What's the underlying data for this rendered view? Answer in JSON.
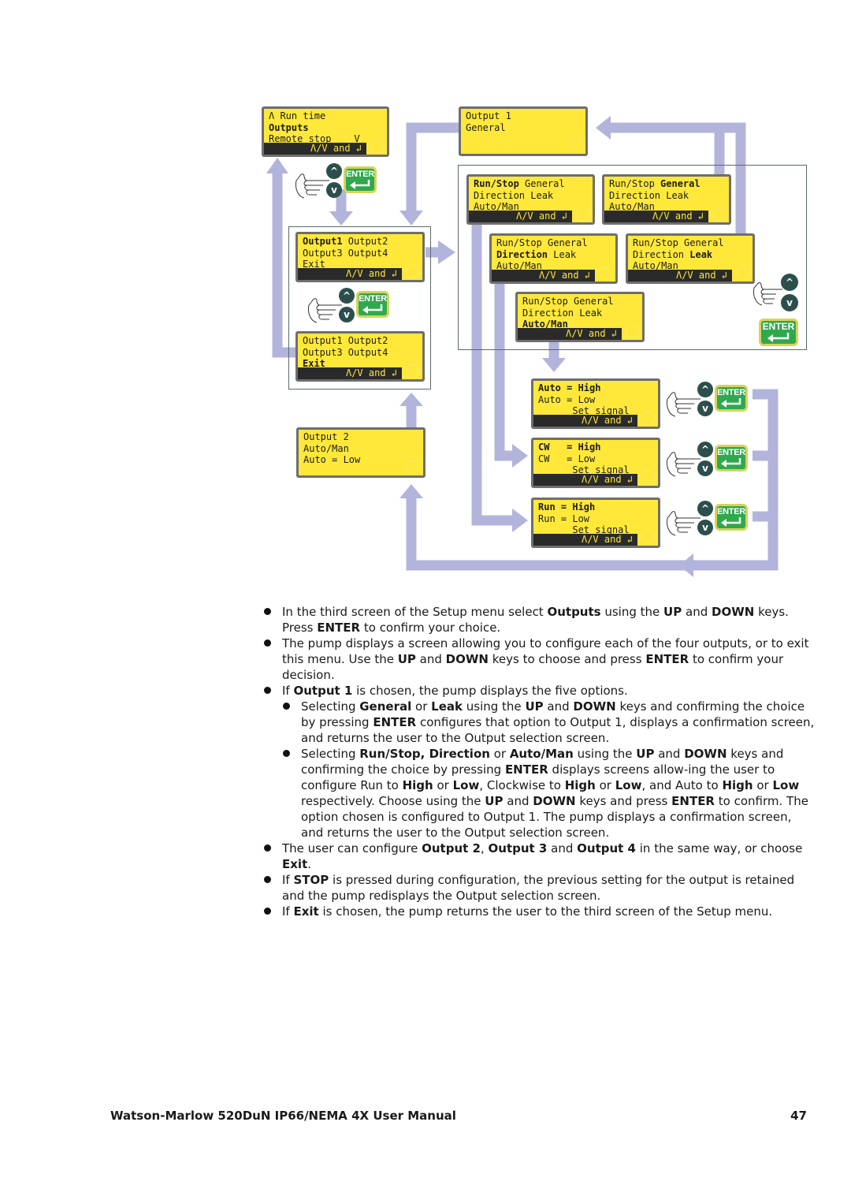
{
  "colors": {
    "lcd_background": "#ffe83a",
    "lcd_bar": "#2a2a2a",
    "arrow": "#b3b4dc",
    "enter_key": "#30a84e",
    "arrow_key": "#2c4f4d"
  },
  "diagram": {
    "nav_hint": "Λ/V and ↲",
    "keys": {
      "up_icon": "^",
      "down_icon": "v",
      "enter_label": "ENTER"
    },
    "screens": {
      "setup_menu": {
        "lines": [
          [
            {
              "t": "Λ Run time",
              "b": false
            }
          ],
          [
            {
              "t": "Outputs",
              "b": true
            }
          ],
          [
            {
              "t": "Remote stop    V",
              "b": false
            }
          ]
        ]
      },
      "output1_general_confirm": {
        "lines": [
          [
            {
              "t": "Output 1",
              "b": false
            }
          ],
          [
            {
              "t": "General",
              "b": false
            }
          ]
        ]
      },
      "outputs_select_output1": {
        "lines": [
          [
            {
              "t": "Output1",
              "b": true
            },
            {
              "t": " Output2",
              "b": false
            }
          ],
          [
            {
              "t": "Output3 Output4",
              "b": false
            }
          ],
          [
            {
              "t": "Exit",
              "b": false
            }
          ]
        ]
      },
      "outputs_select_exit": {
        "lines": [
          [
            {
              "t": "Output1 Output2",
              "b": false
            }
          ],
          [
            {
              "t": "Output3 Output4",
              "b": false
            }
          ],
          [
            {
              "t": "Exit",
              "b": true
            }
          ]
        ]
      },
      "output2_confirm": {
        "lines": [
          [
            {
              "t": "Output 2",
              "b": false
            }
          ],
          [
            {
              "t": "Auto/Man",
              "b": false
            }
          ],
          [
            {
              "t": "Auto = Low",
              "b": false
            }
          ]
        ]
      },
      "options_runstop": {
        "lines": [
          [
            {
              "t": "Run/Stop",
              "b": true
            },
            {
              "t": " General",
              "b": false
            }
          ],
          [
            {
              "t": "Direction Leak",
              "b": false
            }
          ],
          [
            {
              "t": "Auto/Man",
              "b": false
            }
          ]
        ]
      },
      "options_general": {
        "lines": [
          [
            {
              "t": "Run/Stop ",
              "b": false
            },
            {
              "t": "General",
              "b": true
            }
          ],
          [
            {
              "t": "Direction Leak",
              "b": false
            }
          ],
          [
            {
              "t": "Auto/Man",
              "b": false
            }
          ]
        ]
      },
      "options_direction": {
        "lines": [
          [
            {
              "t": "Run/Stop General",
              "b": false
            }
          ],
          [
            {
              "t": "Direction",
              "b": true
            },
            {
              "t": " Leak",
              "b": false
            }
          ],
          [
            {
              "t": "Auto/Man",
              "b": false
            }
          ]
        ]
      },
      "options_leak": {
        "lines": [
          [
            {
              "t": "Run/Stop General",
              "b": false
            }
          ],
          [
            {
              "t": "Direction ",
              "b": false
            },
            {
              "t": "Leak",
              "b": true
            }
          ],
          [
            {
              "t": "Auto/Man",
              "b": false
            }
          ]
        ]
      },
      "options_automan": {
        "lines": [
          [
            {
              "t": "Run/Stop General",
              "b": false
            }
          ],
          [
            {
              "t": "Direction Leak",
              "b": false
            }
          ],
          [
            {
              "t": "Auto/Man",
              "b": true
            }
          ]
        ]
      },
      "auto_setting": {
        "lines": [
          [
            {
              "t": "Auto = High",
              "b": true
            }
          ],
          [
            {
              "t": "Auto = Low",
              "b": false
            }
          ],
          [
            {
              "t": "      Set signal",
              "b": false
            }
          ]
        ]
      },
      "cw_setting": {
        "lines": [
          [
            {
              "t": "CW   = High",
              "b": true
            }
          ],
          [
            {
              "t": "CW   = Low",
              "b": false
            }
          ],
          [
            {
              "t": "      Set signal",
              "b": false
            }
          ]
        ]
      },
      "run_setting": {
        "lines": [
          [
            {
              "t": "Run = High",
              "b": true
            }
          ],
          [
            {
              "t": "Run = Low",
              "b": false
            }
          ],
          [
            {
              "t": "      Set signal",
              "b": false
            }
          ]
        ]
      }
    }
  },
  "body": {
    "bullets": [
      {
        "level": 0,
        "parts": [
          {
            "t": "In the third screen of the Setup menu  select "
          },
          {
            "t": "Outputs",
            "b": true
          },
          {
            "t": " using the "
          },
          {
            "t": "UP",
            "b": true
          },
          {
            "t": " and "
          },
          {
            "t": "DOWN",
            "b": true
          },
          {
            "t": " keys. Press "
          },
          {
            "t": "ENTER",
            "b": true
          },
          {
            "t": " to confirm your choice."
          }
        ]
      },
      {
        "level": 0,
        "parts": [
          {
            "t": "The pump displays a screen allowing you to configure each of the four outputs, or to exit this menu. Use the "
          },
          {
            "t": "UP",
            "b": true
          },
          {
            "t": " and "
          },
          {
            "t": "DOWN",
            "b": true
          },
          {
            "t": " keys to choose and press "
          },
          {
            "t": "ENTER",
            "b": true
          },
          {
            "t": " to confirm your decision."
          }
        ]
      },
      {
        "level": 0,
        "parts": [
          {
            "t": "If "
          },
          {
            "t": "Output 1",
            "b": true
          },
          {
            "t": " is chosen, the pump displays the five options."
          }
        ]
      },
      {
        "level": 1,
        "parts": [
          {
            "t": "Selecting "
          },
          {
            "t": "General",
            "b": true
          },
          {
            "t": " or  "
          },
          {
            "t": "Leak",
            "b": true
          },
          {
            "t": " using the "
          },
          {
            "t": "UP",
            "b": true
          },
          {
            "t": " and "
          },
          {
            "t": "DOWN",
            "b": true
          },
          {
            "t": " keys and confirming the choice by pressing "
          },
          {
            "t": "ENTER",
            "b": true
          },
          {
            "t": " configures that option to Output 1, displays a confirmation screen, and returns the user to the Output selection screen."
          }
        ]
      },
      {
        "level": 1,
        "parts": [
          {
            "t": "Selecting "
          },
          {
            "t": "Run/Stop, Direction",
            "b": true
          },
          {
            "t": " or "
          },
          {
            "t": "Auto/Man",
            "b": true
          },
          {
            "t": " using the "
          },
          {
            "t": "UP",
            "b": true
          },
          {
            "t": " and "
          },
          {
            "t": "DOWN",
            "b": true
          },
          {
            "t": " keys and confirming the choice by pressing "
          },
          {
            "t": "ENTER",
            "b": true
          },
          {
            "t": " displays  screens allow-ing the user to configure Run to "
          },
          {
            "t": "High",
            "b": true
          },
          {
            "t": " or "
          },
          {
            "t": "Low",
            "b": true
          },
          {
            "t": ", Clockwise to "
          },
          {
            "t": "High",
            "b": true
          },
          {
            "t": " or "
          },
          {
            "t": "Low",
            "b": true
          },
          {
            "t": ", and Auto to "
          },
          {
            "t": "High",
            "b": true
          },
          {
            "t": " or "
          },
          {
            "t": "Low",
            "b": true
          },
          {
            "t": " respectively. Choose using the "
          },
          {
            "t": "UP",
            "b": true
          },
          {
            "t": " and "
          },
          {
            "t": "DOWN",
            "b": true
          },
          {
            "t": " keys and press "
          },
          {
            "t": "ENTER",
            "b": true
          },
          {
            "t": " to confirm. The option chosen is configured to Output 1. The pump displays a confirmation screen, and returns the user to the Output selection screen."
          }
        ]
      },
      {
        "level": 0,
        "parts": [
          {
            "t": "The user can configure "
          },
          {
            "t": "Output 2",
            "b": true
          },
          {
            "t": ", "
          },
          {
            "t": "Output 3",
            "b": true
          },
          {
            "t": " and "
          },
          {
            "t": "Output 4",
            "b": true
          },
          {
            "t": " in the same way, or choose "
          },
          {
            "t": "Exit",
            "b": true
          },
          {
            "t": "."
          }
        ]
      },
      {
        "level": 0,
        "parts": [
          {
            "t": "If "
          },
          {
            "t": "STOP",
            "b": true
          },
          {
            "t": " is pressed during configuration, the previous setting for the output is retained and the pump redisplays the Output selection screen."
          }
        ]
      },
      {
        "level": 0,
        "parts": [
          {
            "t": "If "
          },
          {
            "t": "Exit",
            "b": true
          },
          {
            "t": " is chosen, the pump returns the user to the third screen of the Setup menu."
          }
        ]
      }
    ]
  },
  "footer": {
    "title": "Watson-Marlow 520DuN IP66/NEMA 4X User Manual",
    "page_number": "47"
  }
}
